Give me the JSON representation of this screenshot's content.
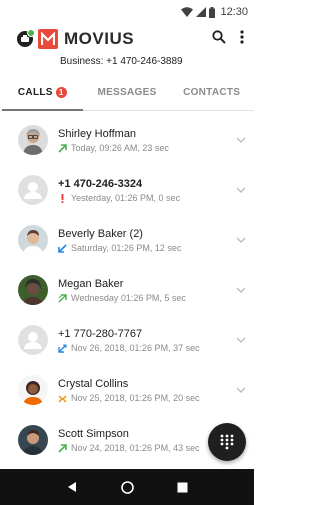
{
  "status_bar": {
    "time": "12:30"
  },
  "app": {
    "brand": "MOVIUS",
    "business_line": "Business: +1 470-246-3889"
  },
  "tabs": [
    {
      "label": "CALLS",
      "badge": "1",
      "active": true
    },
    {
      "label": "MESSAGES",
      "active": false
    },
    {
      "label": "CONTACTS",
      "active": false
    }
  ],
  "calls": [
    {
      "name": "Shirley Hoffman",
      "detail": "Today, 09:26 AM, 23 sec",
      "type": "outgoing",
      "bold": false
    },
    {
      "name": "+1 470-246-3324",
      "detail": "Yesterday, 01:26 PM, 0 sec",
      "type": "missed",
      "bold": true
    },
    {
      "name": "Beverly Baker (2)",
      "detail": "Saturday, 01:26 PM, 12 sec",
      "type": "incoming",
      "bold": false
    },
    {
      "name": "Megan Baker",
      "detail": "Wednesday 01:26 PM, 5 sec",
      "type": "outgoing",
      "bold": false
    },
    {
      "name": "+1 770-280-7767",
      "detail": "Nov 26, 2018, 01:26 PM, 37 sec",
      "type": "forwarded",
      "bold": false
    },
    {
      "name": "Crystal Collins",
      "detail": "Nov 25, 2018, 01:26 PM, 20 sec",
      "type": "merged",
      "bold": false
    },
    {
      "name": "Scott Simpson",
      "detail": "Nov 24, 2018, 01:26 PM, 43 sec",
      "type": "outgoing",
      "bold": false
    }
  ],
  "icons": {
    "outgoing_color": "#4caf50",
    "incoming_color": "#1e88e5",
    "missed_color": "#e53935",
    "merged_color": "#fb8c00",
    "brand_color": "#e8493a"
  }
}
